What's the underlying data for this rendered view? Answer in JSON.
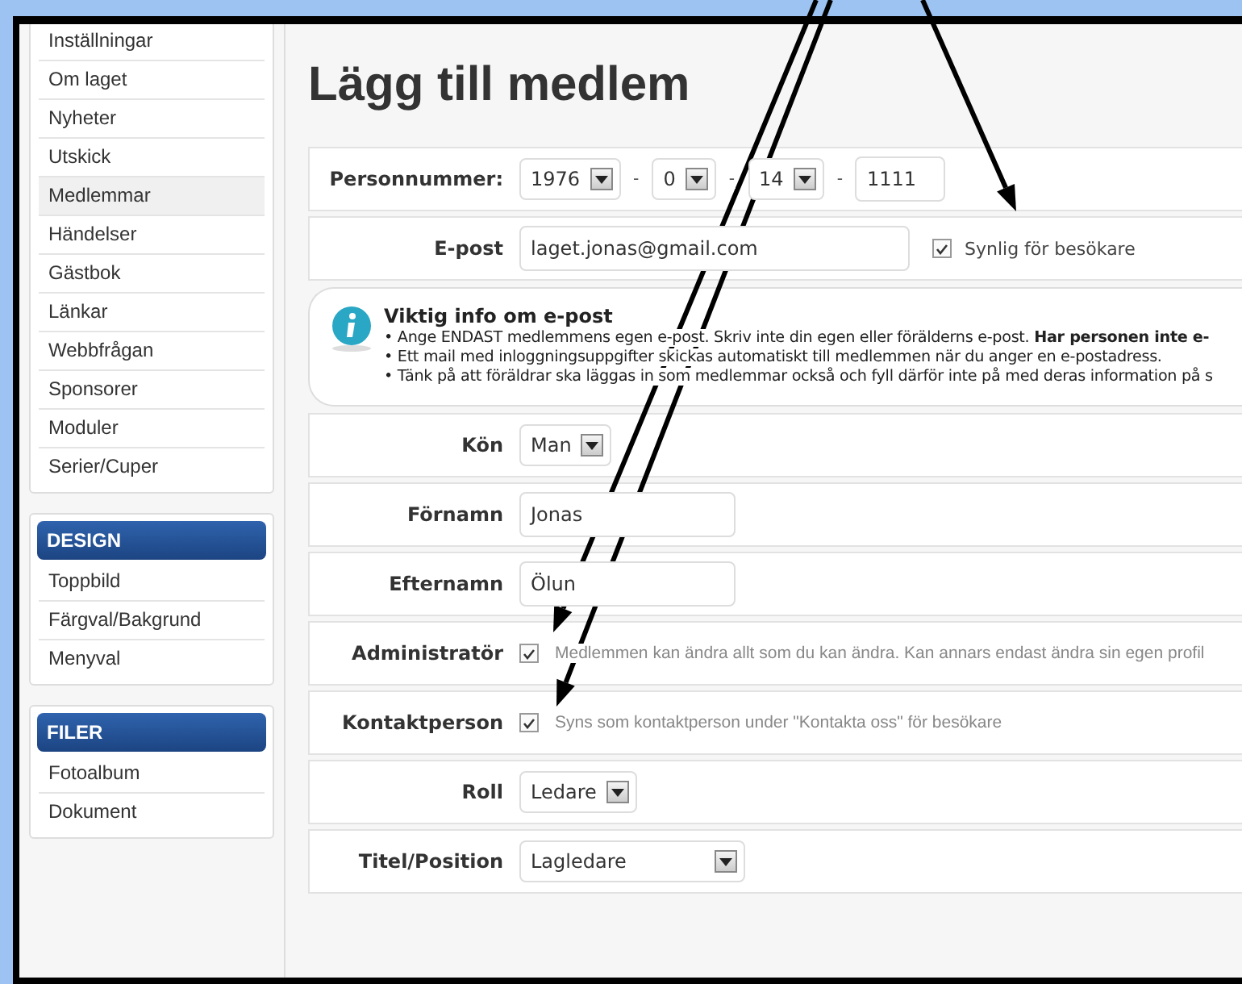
{
  "sidebar": {
    "sections": [
      {
        "items": [
          {
            "label": "Inställningar",
            "selected": false
          },
          {
            "label": "Om laget",
            "selected": false
          },
          {
            "label": "Nyheter",
            "selected": false
          },
          {
            "label": "Utskick",
            "selected": false
          },
          {
            "label": "Medlemmar",
            "selected": true
          },
          {
            "label": "Händelser",
            "selected": false
          },
          {
            "label": "Gästbok",
            "selected": false
          },
          {
            "label": "Länkar",
            "selected": false
          },
          {
            "label": "Webbfrågan",
            "selected": false
          },
          {
            "label": "Sponsorer",
            "selected": false
          },
          {
            "label": "Moduler",
            "selected": false
          },
          {
            "label": "Serier/Cuper",
            "selected": false
          }
        ]
      },
      {
        "title": "DESIGN",
        "items": [
          {
            "label": "Toppbild",
            "selected": false
          },
          {
            "label": "Färgval/Bakgrund",
            "selected": false
          },
          {
            "label": "Menyval",
            "selected": false
          }
        ]
      },
      {
        "title": "FILER",
        "items": [
          {
            "label": "Fotoalbum",
            "selected": false
          },
          {
            "label": "Dokument",
            "selected": false
          }
        ]
      }
    ]
  },
  "page_title": "Lägg till medlem",
  "form": [
    {
      "kind": "personnummer",
      "label": "Personnummer:",
      "parts": [
        {
          "kind": "select",
          "value": "1976"
        },
        {
          "kind": "separator",
          "text": "-"
        },
        {
          "kind": "select",
          "value": "0"
        },
        {
          "kind": "separator",
          "text": "-"
        },
        {
          "kind": "select",
          "value": "14"
        },
        {
          "kind": "separator",
          "text": "-"
        },
        {
          "kind": "input",
          "value": "1111"
        }
      ]
    },
    {
      "kind": "email",
      "label": "E-post",
      "value": "laget.jonas@gmail.com",
      "option": {
        "label": "Synlig för besökare",
        "checked": true
      }
    },
    {
      "kind": "info",
      "title": "Viktig info om e-post",
      "lines": [
        "• Ange ENDAST medlemmens egen e-post. Skriv inte din egen eller förälderns e-post. **Har personen inte e-**",
        "• Ett mail med inloggningsuppgifter skickas automatiskt till medlemmen när du anger en e-postadress.",
        "• Tänk på att föräldrar ska läggas in som medlemmar också och fyll därför inte på med deras information på s"
      ]
    },
    {
      "kind": "select",
      "label": "Kön",
      "value": "Man",
      "wide": false
    },
    {
      "kind": "text",
      "label": "Förnamn",
      "value": "Jonas"
    },
    {
      "kind": "text",
      "label": "Efternamn",
      "value": "Ölun"
    },
    {
      "kind": "checkbox",
      "label": "Administratör",
      "checked": true,
      "hint": "Medlemmen kan ändra allt som du kan ändra. Kan annars endast ändra sin egen profil"
    },
    {
      "kind": "checkbox",
      "label": "Kontaktperson",
      "checked": true,
      "hint": "Syns som kontaktperson under \"Kontakta oss\" för besökare"
    },
    {
      "kind": "select",
      "label": "Roll",
      "value": "Ledare",
      "wide": false
    },
    {
      "kind": "select",
      "label": "Titel/Position",
      "value": "Lagledare",
      "wide": true
    }
  ]
}
